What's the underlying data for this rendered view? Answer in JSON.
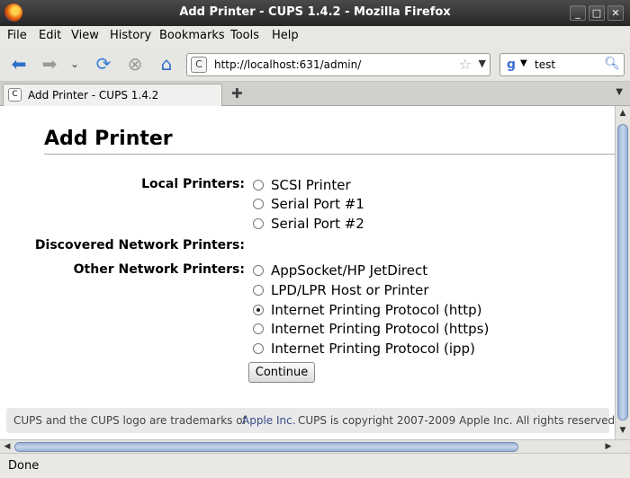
{
  "window": {
    "title": "Add Printer - CUPS 1.4.2 - Mozilla Firefox"
  },
  "menu": [
    {
      "label": "File"
    },
    {
      "label": "Edit"
    },
    {
      "label": "View"
    },
    {
      "label": "History"
    },
    {
      "label": "Bookmarks"
    },
    {
      "label": "Tools"
    },
    {
      "label": "Help"
    }
  ],
  "navbar": {
    "url": "http://localhost:631/admin/",
    "search_value": "test"
  },
  "tab": {
    "title": "Add Printer - CUPS 1.4.2"
  },
  "page": {
    "title": "Add Printer",
    "local_label": "Local Printers:",
    "local_options": [
      "SCSI Printer",
      "Serial Port #1",
      "Serial Port #2"
    ],
    "discovered_label": "Discovered Network Printers:",
    "other_label": "Other Network Printers:",
    "other_options": [
      "AppSocket/HP JetDirect",
      "LPD/LPR Host or Printer",
      "Internet Printing Protocol (http)",
      "Internet Printing Protocol (https)",
      "Internet Printing Protocol (ipp)"
    ],
    "selected_option": "Internet Printing Protocol (http)",
    "continue_label": "Continue",
    "footer_prefix": "CUPS and the CUPS logo are trademarks of",
    "footer_link": "Apple Inc.",
    "footer_suffix": "CUPS is copyright 2007-2009 Apple Inc. All rights reserved."
  },
  "status": {
    "text": "Done"
  },
  "colors": {
    "titlebar": "#333333",
    "scroll_thumb": "#9ab1d4",
    "link": "#3a4a8a"
  }
}
